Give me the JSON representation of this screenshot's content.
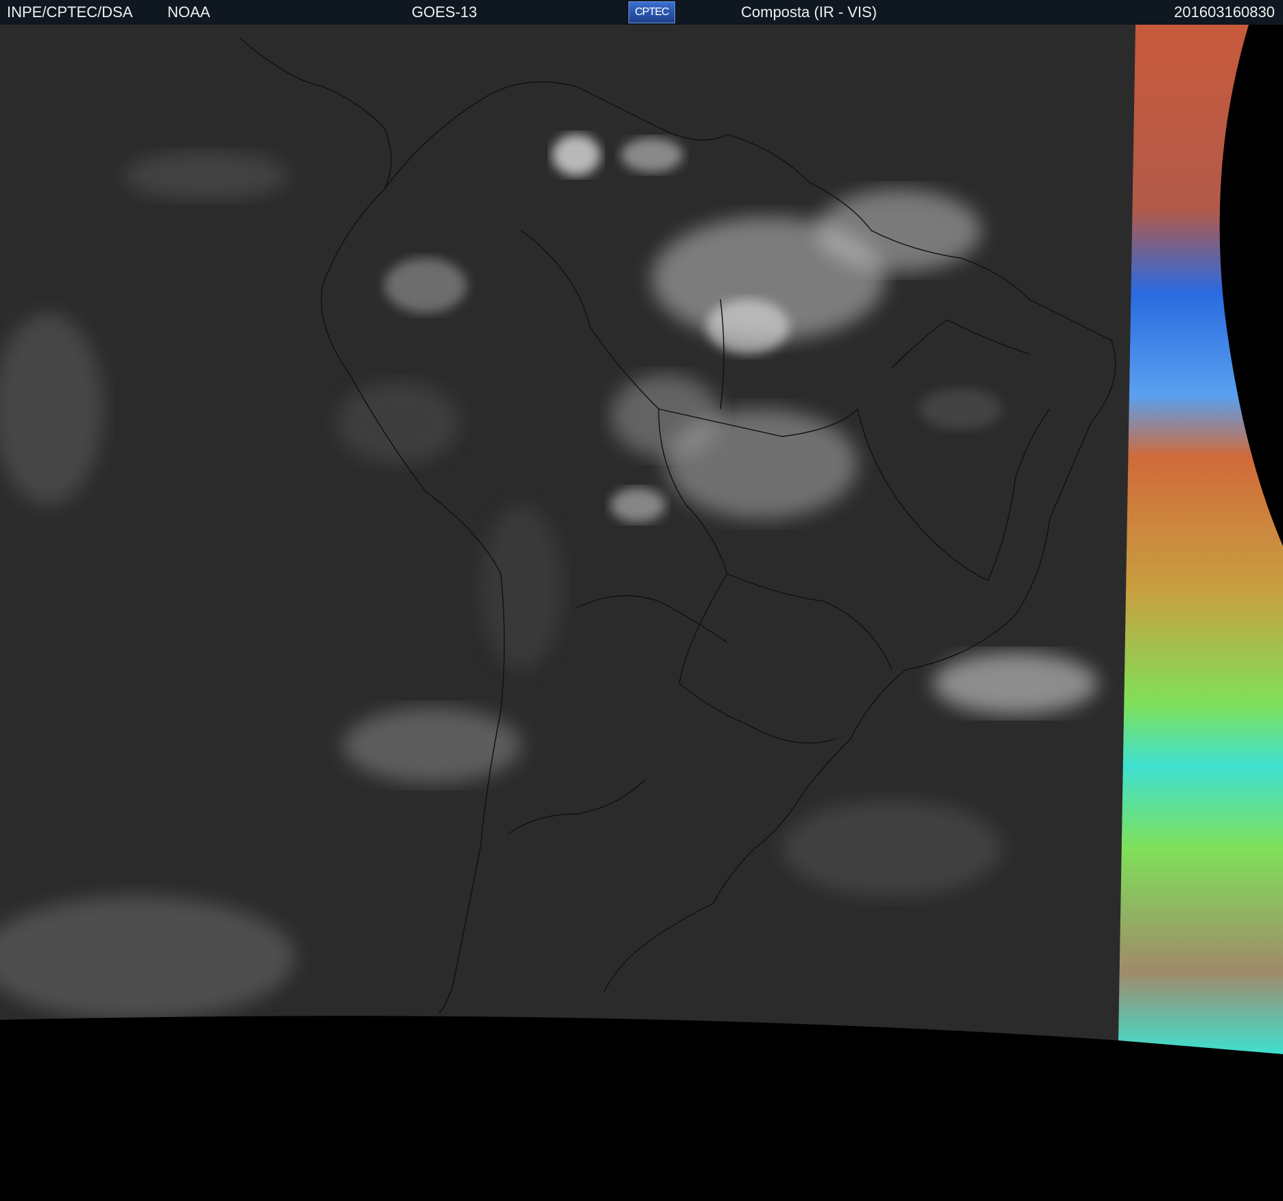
{
  "header": {
    "organization": "INPE/CPTEC/DSA",
    "agency": "NOAA",
    "satellite": "GOES-13",
    "logo_text": "CPTEC",
    "product": "Composta (IR - VIS)",
    "timestamp": "201603160830"
  },
  "colors": {
    "header_background": "#0f1820",
    "header_text": "#f0f0f0",
    "ir_background": "#2b2b2b",
    "space_background": "#000000",
    "vis_strip_red": "#c85a3c",
    "vis_strip_blue": "#2a6ae0",
    "vis_strip_green": "#7fe05a",
    "vis_strip_cyan": "#3fe0d0"
  },
  "icons": {
    "logo": "cptec-logo"
  }
}
